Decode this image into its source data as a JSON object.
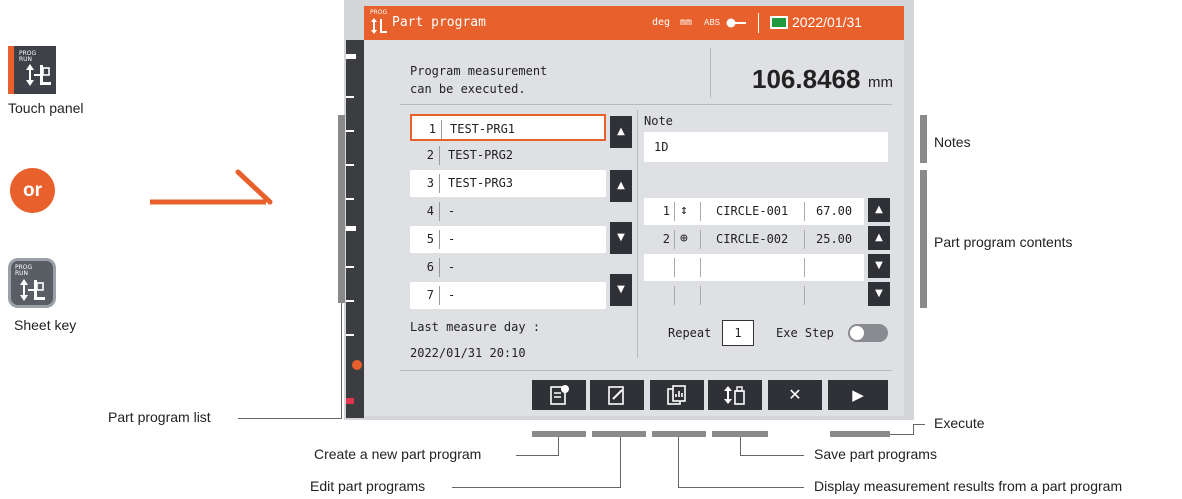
{
  "left_panel": {
    "key_text": "PROG\nRUN",
    "touch_label": "Touch panel",
    "or_label": "or",
    "sheet_label": "Sheet key"
  },
  "screen": {
    "title_icon_text": "PROG",
    "title": "Part program",
    "status": {
      "unit1": "deg",
      "unit2": "mm",
      "mode": "ABS",
      "date": "2022/01/31"
    },
    "message_line1": "Program measurement",
    "message_line2": "can be executed.",
    "value": "106.8468",
    "value_unit": "mm",
    "programs": [
      {
        "num": "1",
        "name": "TEST-PRG1"
      },
      {
        "num": "2",
        "name": "TEST-PRG2"
      },
      {
        "num": "3",
        "name": "TEST-PRG3"
      },
      {
        "num": "4",
        "name": "-"
      },
      {
        "num": "5",
        "name": "-"
      },
      {
        "num": "6",
        "name": "-"
      },
      {
        "num": "7",
        "name": "-"
      }
    ],
    "last_measure_label": "Last measure day   :",
    "last_measure_value": "2022/01/31 20:10",
    "note_label": "Note",
    "note_value": "1D",
    "contents": [
      {
        "num": "1",
        "icon": "↕",
        "name": "CIRCLE-001",
        "value": "67.00"
      },
      {
        "num": "2",
        "icon": "⊕",
        "name": "CIRCLE-002",
        "value": "25.00"
      }
    ],
    "repeat_label": "Repeat",
    "repeat_value": "1",
    "exe_step_label": "Exe Step"
  },
  "callouts": {
    "notes": "Notes",
    "contents": "Part program contents",
    "list": "Part program list",
    "execute": "Execute",
    "create": "Create a new part program",
    "save": "Save part programs",
    "edit": "Edit part programs",
    "display": "Display measurement results from a part program"
  }
}
